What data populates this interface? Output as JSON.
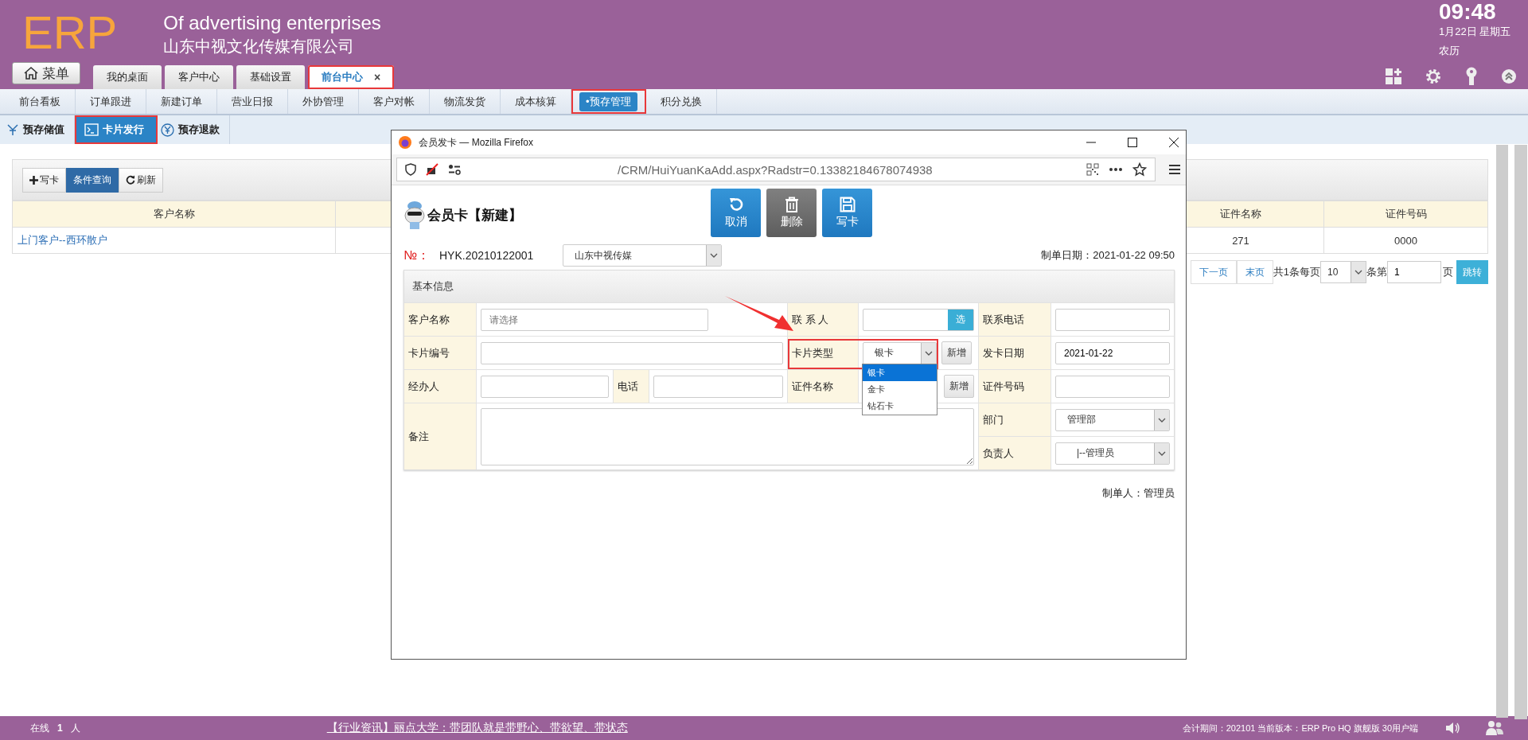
{
  "header": {
    "logo": "ERP",
    "slogan": "Of advertising enterprises",
    "company": "山东中视文化传媒有限公司",
    "clock": {
      "time": "09:48",
      "date": "1月22日 星期五",
      "lunar": "农历"
    }
  },
  "menu_button": "菜单",
  "tabs": [
    {
      "label": "我的桌面",
      "selected": false,
      "highlighted": false
    },
    {
      "label": "客户中心",
      "selected": false,
      "highlighted": false
    },
    {
      "label": "基础设置",
      "selected": false,
      "highlighted": false
    },
    {
      "label": "前台中心",
      "selected": true,
      "highlighted": true,
      "close": "×"
    }
  ],
  "nav": [
    {
      "label": "前台看板",
      "selected": false,
      "highlighted": false
    },
    {
      "label": "订单跟进",
      "selected": false,
      "highlighted": false
    },
    {
      "label": "新建订单",
      "selected": false,
      "highlighted": false
    },
    {
      "label": "营业日报",
      "selected": false,
      "highlighted": false
    },
    {
      "label": "外协管理",
      "selected": false,
      "highlighted": false
    },
    {
      "label": "客户对帐",
      "selected": false,
      "highlighted": false
    },
    {
      "label": "物流发货",
      "selected": false,
      "highlighted": false
    },
    {
      "label": "成本核算",
      "selected": false,
      "highlighted": false
    },
    {
      "label": "•预存管理",
      "selected": true,
      "highlighted": true
    },
    {
      "label": "积分兑换",
      "selected": false,
      "highlighted": false
    }
  ],
  "subnav": [
    {
      "label": "预存储值",
      "kind": "yen",
      "selected": false,
      "highlighted": false
    },
    {
      "label": "卡片发行",
      "kind": "terminal",
      "selected": true,
      "highlighted": true
    },
    {
      "label": "预存退款",
      "kind": "yen-circle",
      "selected": false,
      "highlighted": false
    }
  ],
  "toolbar": [
    {
      "label": "写卡",
      "kind": "add",
      "selected": false
    },
    {
      "label": "条件查询",
      "kind": "plain",
      "selected": true
    },
    {
      "label": "刷新",
      "kind": "refresh",
      "selected": false
    }
  ],
  "table": {
    "columns": [
      "客户名称",
      "证件名称",
      "证件号码"
    ],
    "rows": [
      {
        "cells": [
          "上门客户--西环散户",
          "271",
          "0000"
        ]
      }
    ]
  },
  "pagination": {
    "next": "下一页",
    "last": "末页",
    "total": "共1条每页",
    "page_size": "10",
    "page_of": "条第",
    "page": "1",
    "page_suffix": "页",
    "go": "跳转"
  },
  "dialog": {
    "window_title": "会员发卡 — Mozilla Firefox",
    "url": "/CRM/HuiYuanKaAdd.aspx?Radstr=0.13382184678074938",
    "heading": "会员卡【新建】",
    "buttons": [
      {
        "label": "取消",
        "kind": "undo"
      },
      {
        "label": "删除",
        "kind": "delete"
      },
      {
        "label": "写卡",
        "kind": "save"
      }
    ],
    "no_label": "№：",
    "no": "HYK.20210122001",
    "company_select": "山东中视传媒",
    "created_at": "制单日期：2021-01-22 09:50",
    "section": "基本信息",
    "customer": {
      "label": "客户名称",
      "placeholder": "请选择"
    },
    "contact": {
      "label": "联 系 人",
      "button": "选"
    },
    "contact_phone": {
      "label": "联系电话"
    },
    "card_no": {
      "label": "卡片编号"
    },
    "card_type": {
      "label": "卡片类型",
      "value": "银卡",
      "button": "新增",
      "highlighted": true,
      "expanded": true,
      "options": [
        {
          "label": "银卡",
          "selected": true
        },
        {
          "label": "金卡",
          "selected": false
        },
        {
          "label": "钻石卡",
          "selected": false
        }
      ]
    },
    "issue_date": {
      "label": "发卡日期",
      "value": "2021-01-22"
    },
    "handler": {
      "label": "经办人"
    },
    "phone": {
      "label": "电话"
    },
    "id_name": {
      "label": "证件名称",
      "button": "新增"
    },
    "id_no": {
      "label": "证件号码"
    },
    "remark": {
      "label": "备注"
    },
    "department": {
      "label": "部门",
      "value": "管理部"
    },
    "owner": {
      "label": "负责人",
      "value": "|--管理员"
    },
    "creator": "制单人：管理员"
  },
  "status_bar": {
    "online_label": "在线",
    "online_count": "1",
    "online_unit": "人",
    "news": "【行业资讯】丽点大学：带团队就是带野心、带欲望、带状态",
    "info": "会计期间：202101 当前版本：ERP Pro HQ 旗舰版 30用户端"
  }
}
